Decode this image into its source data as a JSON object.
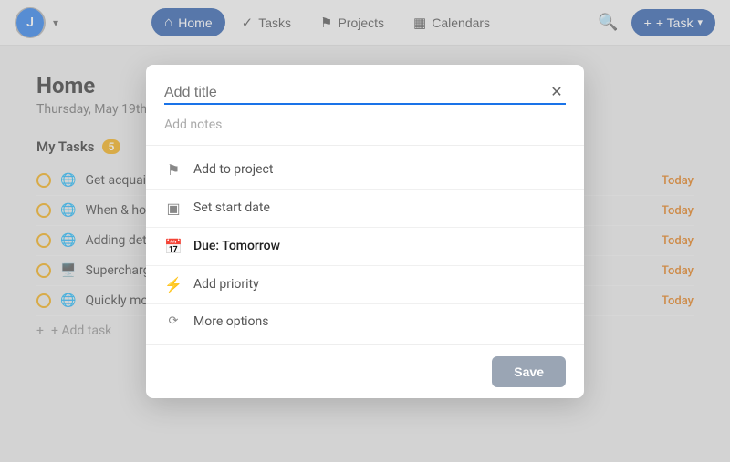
{
  "nav": {
    "avatar_initial": "J",
    "chevron_label": "▾",
    "tabs": [
      {
        "id": "home",
        "label": "Home",
        "icon": "⌂",
        "active": true
      },
      {
        "id": "tasks",
        "label": "Tasks",
        "icon": "✓"
      },
      {
        "id": "projects",
        "label": "Projects",
        "icon": "⚑"
      },
      {
        "id": "calendars",
        "label": "Calendars",
        "icon": "▦"
      }
    ],
    "search_label": "🔍",
    "add_task_label": "+ Task"
  },
  "page": {
    "title": "Home",
    "date": "Thursday, May 19th"
  },
  "my_tasks": {
    "section_title": "My Tasks",
    "badge_count": "5",
    "tasks": [
      {
        "icon": "🌐",
        "text": "Get acquainted w...",
        "due": "Today"
      },
      {
        "icon": "🌐",
        "text": "When & how to...",
        "due": "Today"
      },
      {
        "icon": "🌐",
        "text": "Adding detail to...",
        "due": "Today"
      },
      {
        "icon": "🖥️",
        "text": "Supercharge tas...",
        "due": "Today"
      },
      {
        "icon": "🌐",
        "text": "Quickly move tas...",
        "due": "Today"
      }
    ],
    "add_task_label": "+ Add task"
  },
  "modal": {
    "title_placeholder": "Add title",
    "notes_label": "Add notes",
    "close_icon": "✕",
    "options": [
      {
        "id": "add-to-project",
        "icon": "⚑",
        "label": "Add to project",
        "active": false
      },
      {
        "id": "set-start-date",
        "icon": "□",
        "label": "Set start date",
        "active": false
      },
      {
        "id": "due-tomorrow",
        "icon": "📅",
        "label": "Due: Tomorrow",
        "active": true
      },
      {
        "id": "add-priority",
        "icon": "⚡",
        "label": "Add priority",
        "active": false
      },
      {
        "id": "more-options",
        "icon": "⟳",
        "label": "More options",
        "active": false
      }
    ],
    "save_button_label": "Save"
  }
}
